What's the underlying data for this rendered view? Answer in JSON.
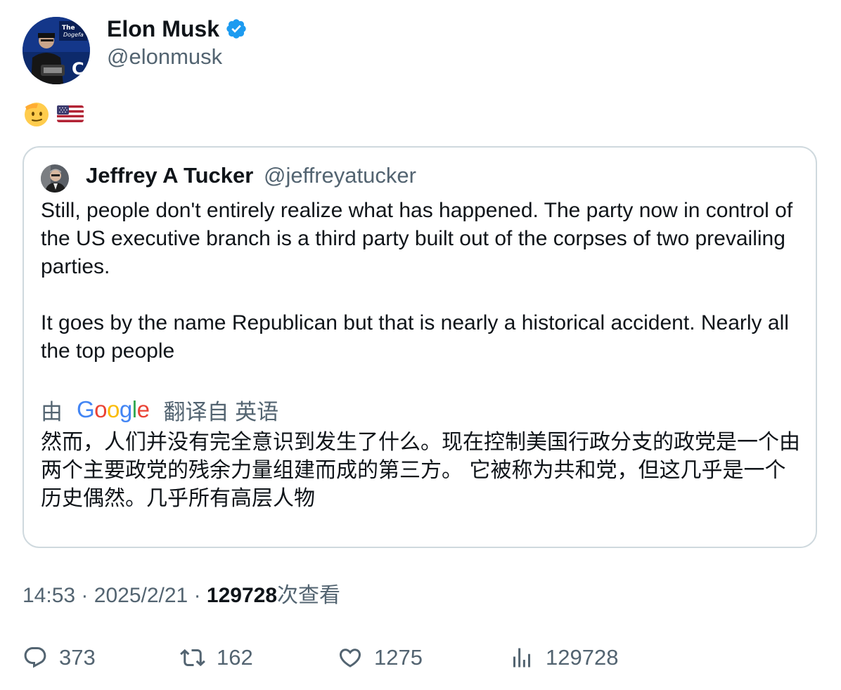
{
  "author": {
    "name": "Elon Musk",
    "handle": "@elonmusk"
  },
  "tweet": {
    "emoji": [
      "salute-face",
      "us-flag"
    ]
  },
  "quoted": {
    "name": "Jeffrey A Tucker",
    "handle": "@jeffreyatucker",
    "paragraph1": "Still, people don't entirely realize what has happened. The party now in control of the US executive branch is a third party built out of the corpses of two prevailing parties.",
    "paragraph2": "It goes by the name Republican but that is nearly a historical accident. Nearly all the top people",
    "translation_prefix": "由",
    "translation_brand": "Google",
    "translation_suffix": "翻译自 英语",
    "translated_text": "然而，人们并没有完全意识到发生了什么。现在控制美国行政分支的政党是一个由两个主要政党的残余力量组建而成的第三方。 它被称为共和党，但这几乎是一个历史偶然。几乎所有高层人物"
  },
  "meta": {
    "time": "14:53",
    "sep1": "·",
    "date": "2025/2/21",
    "sep2": "·",
    "views_count": "129728",
    "views_label": "次查看"
  },
  "actions": {
    "replies": "373",
    "reposts": "162",
    "likes": "1275",
    "views": "129728"
  },
  "colors": {
    "text_primary": "#0f1419",
    "text_secondary": "#536471",
    "verified_blue": "#1d9bf0",
    "card_border": "#cfd9de"
  }
}
